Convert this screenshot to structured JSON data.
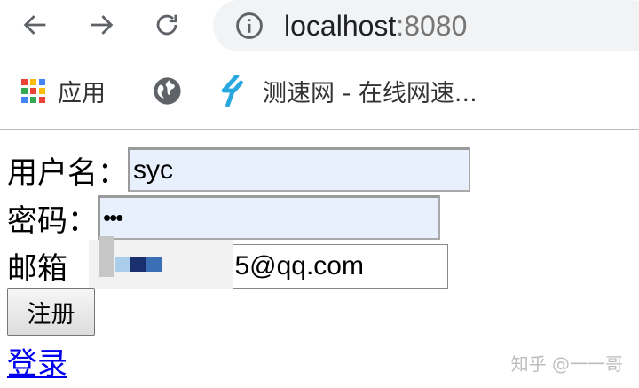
{
  "browser": {
    "url_host": "localhost",
    "url_port": ":8080",
    "bookmarks": [
      {
        "label": "应用",
        "icon": "apps-grid-icon"
      },
      {
        "label": "",
        "icon": "globe-icon"
      },
      {
        "label": "测速网 - 在线网速...",
        "icon": "speedtest-logo-icon"
      }
    ]
  },
  "form": {
    "username_label": "用户名：",
    "username_value": "syc",
    "password_label": "密码：",
    "password_value": "•••",
    "email_label": "邮箱",
    "email_value_visible": "5@qq.com",
    "register_label": "注册",
    "login_link": "登录"
  },
  "watermark": "知乎 @一一哥",
  "colors": {
    "autofill_bg": "#e8f0fe",
    "link": "#0000ee",
    "redact_dark": "#1a2f6e",
    "redact_mid": "#3a6fb5",
    "redact_light": "#a9cdea"
  }
}
